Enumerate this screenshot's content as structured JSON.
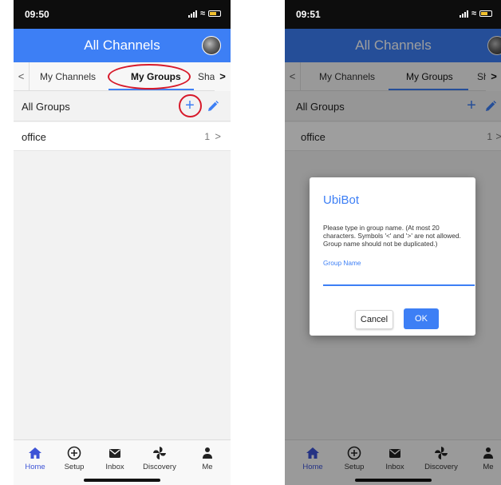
{
  "colors": {
    "accent": "#3d7ff5",
    "annotation": "#d7192a",
    "nav_active": "#3d53d6"
  },
  "left_screen": {
    "status": {
      "time": "09:50"
    },
    "appbar": {
      "title": "All Channels"
    },
    "tabs": [
      {
        "label": "My Channels"
      },
      {
        "label": "My Groups",
        "active": true
      },
      {
        "label": "Sha"
      }
    ],
    "groups_header": {
      "label": "All Groups"
    },
    "groups": [
      {
        "name": "office",
        "count": "1"
      }
    ]
  },
  "right_screen": {
    "status": {
      "time": "09:51"
    },
    "appbar": {
      "title": "All Channels"
    },
    "tabs": [
      {
        "label": "My Channels"
      },
      {
        "label": "My Groups",
        "active": true
      },
      {
        "label": "Sha"
      }
    ],
    "groups_header": {
      "label": "All Groups"
    },
    "groups": [
      {
        "name": "office",
        "count": "1"
      }
    ],
    "dialog": {
      "title": "UbiBot",
      "message": "Please type in group name. (At most 20 characters. Symbols '<' and '>' are not allowed. Group name should not be duplicated.)",
      "field_label": "Group Name",
      "field_value": "",
      "cancel_label": "Cancel",
      "ok_label": "OK"
    }
  },
  "bottom_nav": [
    {
      "label": "Home",
      "icon": "home-icon",
      "active": true
    },
    {
      "label": "Setup",
      "icon": "add-circle-icon"
    },
    {
      "label": "Inbox",
      "icon": "mail-icon"
    },
    {
      "label": "Discovery",
      "icon": "pinwheel-icon"
    },
    {
      "label": "Me",
      "icon": "person-icon"
    }
  ]
}
